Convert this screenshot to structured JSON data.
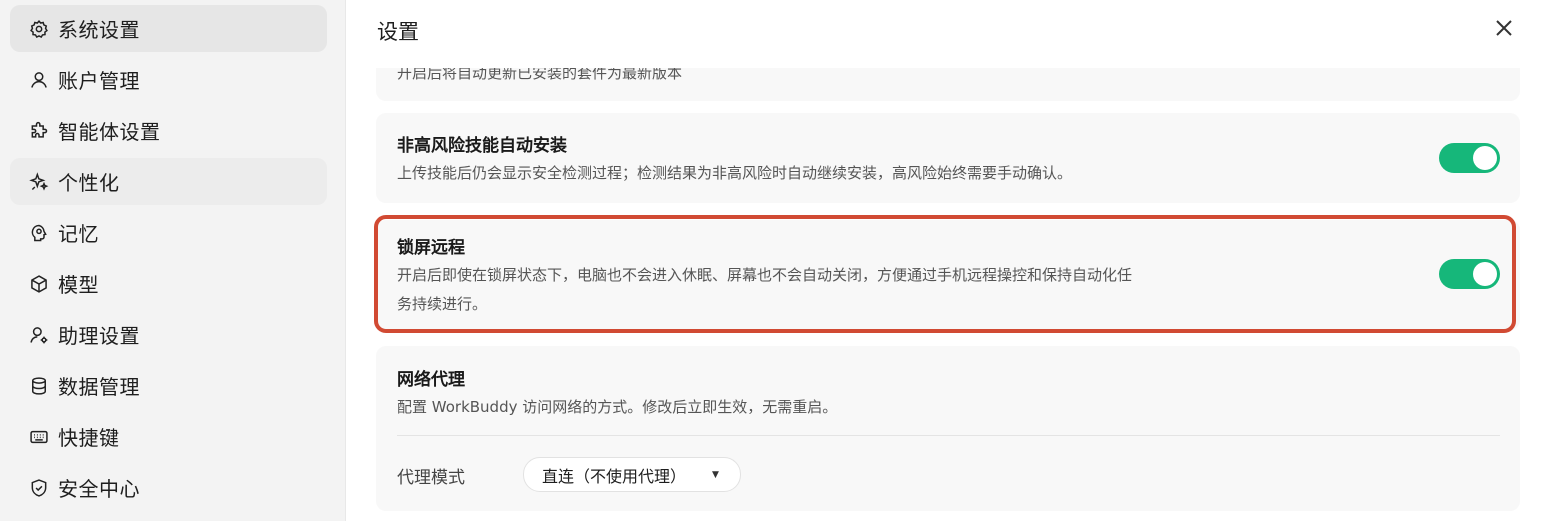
{
  "sidebar": {
    "items": [
      {
        "label": "系统设置",
        "icon": "gear-icon"
      },
      {
        "label": "账户管理",
        "icon": "user-icon"
      },
      {
        "label": "智能体设置",
        "icon": "puzzle-icon"
      },
      {
        "label": "个性化",
        "icon": "sparkle-icon"
      },
      {
        "label": "记忆",
        "icon": "brain-icon"
      },
      {
        "label": "模型",
        "icon": "cube-icon"
      },
      {
        "label": "助理设置",
        "icon": "user-gear-icon"
      },
      {
        "label": "数据管理",
        "icon": "database-icon"
      },
      {
        "label": "快捷键",
        "icon": "keyboard-icon"
      },
      {
        "label": "安全中心",
        "icon": "shield-icon"
      }
    ]
  },
  "main": {
    "title": "设置",
    "cards": {
      "auto_update": {
        "desc": "开启后将自动更新已安装的套件为最新版本"
      },
      "auto_install": {
        "title": "非高风险技能自动安装",
        "desc": "上传技能后仍会显示安全检测过程；检测结果为非高风险时自动继续安装，高风险始终需要手动确认。",
        "enabled": true
      },
      "lock_screen": {
        "title": "锁屏远程",
        "desc_line1": "开启后即使在锁屏状态下，电脑也不会进入休眠、屏幕也不会自动关闭，方便通过手机远程操控和保持自动化任",
        "desc_line2": "务持续进行。",
        "enabled": true
      },
      "proxy": {
        "title": "网络代理",
        "desc": "配置 WorkBuddy 访问网络的方式。修改后立即生效，无需重启。",
        "mode_label": "代理模式",
        "mode_value": "直连（不使用代理）"
      }
    }
  },
  "colors": {
    "toggle_on": "#16b77a",
    "highlight": "#d14a33"
  }
}
